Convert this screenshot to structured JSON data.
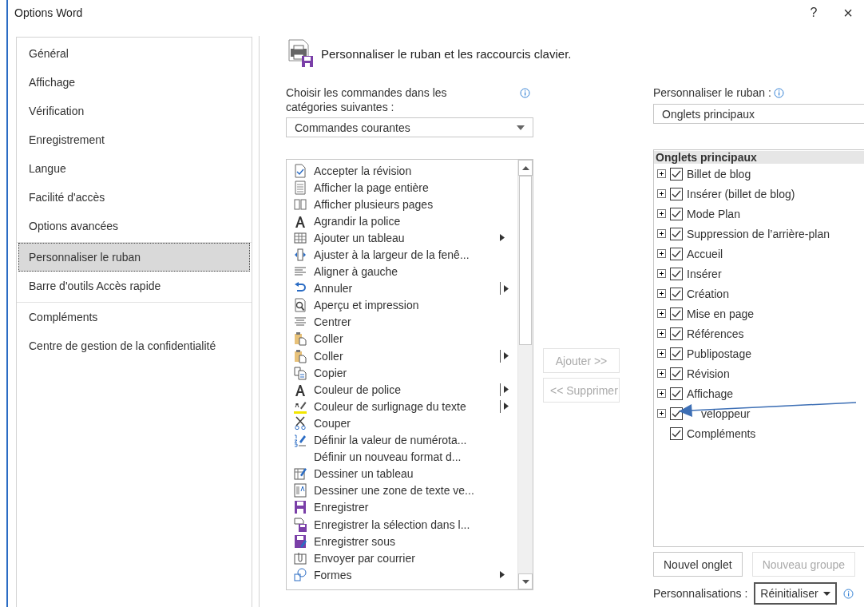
{
  "window": {
    "title": "Options Word",
    "help": "?",
    "close": "×"
  },
  "sidebar": {
    "groups": [
      [
        {
          "label": "Général",
          "selected": false
        },
        {
          "label": "Affichage",
          "selected": false
        },
        {
          "label": "Vérification",
          "selected": false
        },
        {
          "label": "Enregistrement",
          "selected": false
        },
        {
          "label": "Langue",
          "selected": false
        },
        {
          "label": "Facilité d'accès",
          "selected": false
        },
        {
          "label": "Options avancées",
          "selected": false
        }
      ],
      [
        {
          "label": "Personnaliser le ruban",
          "selected": true
        },
        {
          "label": "Barre d'outils Accès rapide",
          "selected": false
        }
      ],
      [
        {
          "label": "Compléments",
          "selected": false
        },
        {
          "label": "Centre de gestion de la confidentialité",
          "selected": false
        }
      ]
    ]
  },
  "header": {
    "title": "Personnaliser le ruban et les raccourcis clavier."
  },
  "commands": {
    "label": "Choisir les commandes dans les catégories suivantes :",
    "dropdown": "Commandes courantes",
    "items": [
      {
        "label": "Accepter la révision",
        "submenu": false,
        "split": false
      },
      {
        "label": "Afficher la page entière",
        "submenu": false,
        "split": false
      },
      {
        "label": "Afficher plusieurs pages",
        "submenu": false,
        "split": false
      },
      {
        "label": "Agrandir la police",
        "submenu": false,
        "split": false
      },
      {
        "label": "Ajouter un tableau",
        "submenu": true,
        "split": false
      },
      {
        "label": "Ajuster à la largeur de la fenê...",
        "submenu": false,
        "split": false
      },
      {
        "label": "Aligner à gauche",
        "submenu": false,
        "split": false
      },
      {
        "label": "Annuler",
        "submenu": true,
        "split": true
      },
      {
        "label": "Aperçu et impression",
        "submenu": false,
        "split": false
      },
      {
        "label": "Centrer",
        "submenu": false,
        "split": false
      },
      {
        "label": "Coller",
        "submenu": false,
        "split": false
      },
      {
        "label": "Coller",
        "submenu": true,
        "split": true
      },
      {
        "label": "Copier",
        "submenu": false,
        "split": false
      },
      {
        "label": "Couleur de police",
        "submenu": true,
        "split": true
      },
      {
        "label": "Couleur de surlignage du texte",
        "submenu": true,
        "split": true
      },
      {
        "label": "Couper",
        "submenu": false,
        "split": false
      },
      {
        "label": "Définir la valeur de numérota...",
        "submenu": false,
        "split": false
      },
      {
        "label": "Définir un nouveau format d...",
        "submenu": false,
        "split": false
      },
      {
        "label": "Dessiner un tableau",
        "submenu": false,
        "split": false
      },
      {
        "label": "Dessiner une zone de texte ve...",
        "submenu": false,
        "split": false
      },
      {
        "label": "Enregistrer",
        "submenu": false,
        "split": false
      },
      {
        "label": "Enregistrer la sélection dans l...",
        "submenu": false,
        "split": false
      },
      {
        "label": "Enregistrer sous",
        "submenu": false,
        "split": false
      },
      {
        "label": "Envoyer par courrier",
        "submenu": false,
        "split": false
      },
      {
        "label": "Formes",
        "submenu": true,
        "split": false
      }
    ]
  },
  "actions": [
    {
      "label": "Ajouter >>",
      "disabled": true
    },
    {
      "label": "<< Supprimer",
      "disabled": true
    }
  ],
  "ribbon": {
    "label": "Personnaliser le ruban :",
    "dropdown": "Onglets principaux",
    "tree_header": "Onglets principaux",
    "tabs": [
      {
        "label": "Billet de blog",
        "checked": true,
        "expandable": true
      },
      {
        "label": "Insérer (billet de blog)",
        "checked": true,
        "expandable": true
      },
      {
        "label": "Mode Plan",
        "checked": true,
        "expandable": true
      },
      {
        "label": "Suppression de l’arrière-plan",
        "checked": true,
        "expandable": true
      },
      {
        "label": "Accueil",
        "checked": true,
        "expandable": true
      },
      {
        "label": "Insérer",
        "checked": true,
        "expandable": true
      },
      {
        "label": "Création",
        "checked": true,
        "expandable": true
      },
      {
        "label": "Mise en page",
        "checked": true,
        "expandable": true
      },
      {
        "label": "Références",
        "checked": true,
        "expandable": true
      },
      {
        "label": "Publipostage",
        "checked": true,
        "expandable": true
      },
      {
        "label": "Révision",
        "checked": true,
        "expandable": true
      },
      {
        "label": "Affichage",
        "checked": true,
        "expandable": true
      },
      {
        "label": "veloppeur",
        "checked": true,
        "expandable": true,
        "arrow_over": true
      },
      {
        "label": "Compléments",
        "checked": true,
        "expandable": false
      }
    ],
    "buttons": [
      {
        "label": "Nouvel onglet",
        "disabled": false
      },
      {
        "label": "Nouveau groupe",
        "disabled": true
      }
    ],
    "customizations_label": "Personnalisations :",
    "reset": "Réinitialiser"
  }
}
